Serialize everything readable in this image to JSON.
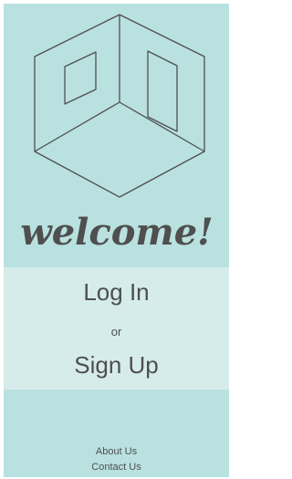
{
  "hero": {
    "logo_icon": "isometric-room-icon",
    "welcome_text": "welcome!"
  },
  "auth": {
    "login_label": "Log In",
    "or_label": "or",
    "signup_label": "Sign Up"
  },
  "footer": {
    "about_label": "About Us",
    "contact_label": "Contact Us"
  },
  "colors": {
    "background": "#b9e1e0",
    "band": "#d5eceb",
    "ink": "#4f4f4f"
  }
}
